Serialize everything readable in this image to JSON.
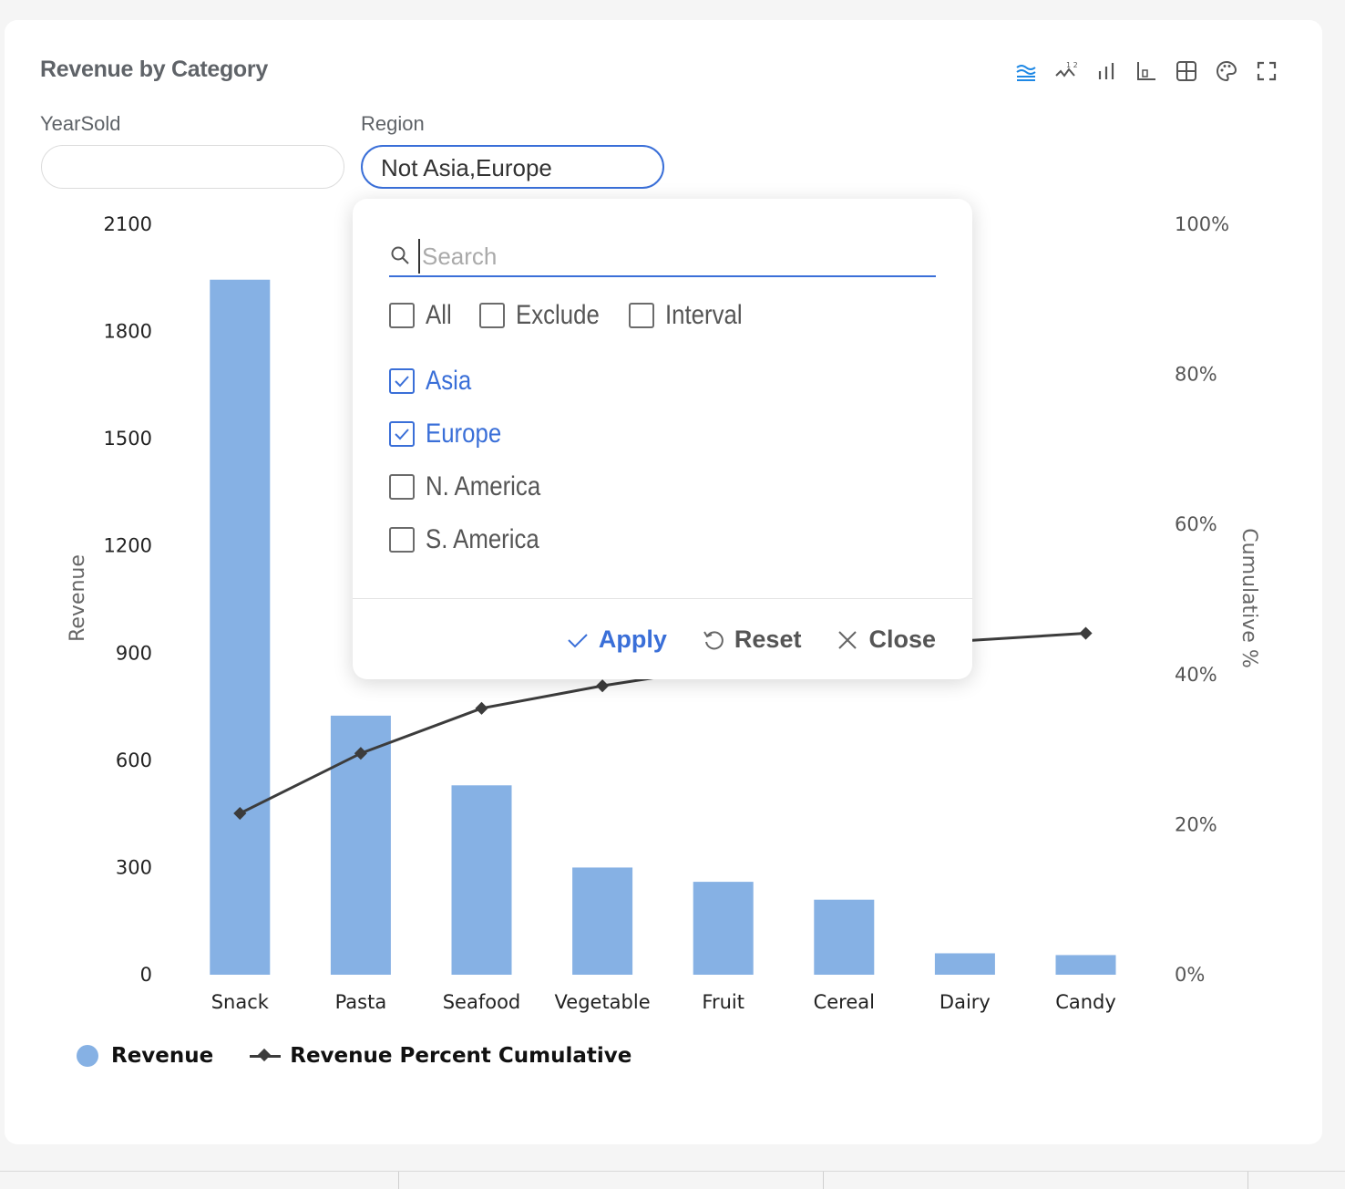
{
  "title": "Revenue by Category",
  "toolbar": {
    "icons": [
      "stacked-area-icon",
      "line-numbers-icon",
      "bar-chart-icon",
      "axis-icon",
      "grid-icon",
      "palette-icon",
      "fullscreen-icon"
    ]
  },
  "filters": {
    "yearsold": {
      "label": "YearSold",
      "value": ""
    },
    "region": {
      "label": "Region",
      "value": "Not Asia,Europe"
    }
  },
  "dropdown": {
    "search_placeholder": "Search",
    "modes": [
      {
        "label": "All",
        "checked": false
      },
      {
        "label": "Exclude",
        "checked": false
      },
      {
        "label": "Interval",
        "checked": false
      }
    ],
    "options": [
      {
        "label": "Asia",
        "checked": true
      },
      {
        "label": "Europe",
        "checked": true
      },
      {
        "label": "N. America",
        "checked": false
      },
      {
        "label": "S. America",
        "checked": false
      }
    ],
    "apply_label": "Apply",
    "reset_label": "Reset",
    "close_label": "Close"
  },
  "colors": {
    "bar": "#86b1e4",
    "line": "#3c3c3c",
    "accent": "#3a6fd8"
  },
  "chart_data": {
    "type": "bar",
    "categories": [
      "Snack",
      "Pasta",
      "Seafood",
      "Vegetable",
      "Fruit",
      "Cereal",
      "Dairy",
      "Candy"
    ],
    "series": [
      {
        "name": "Revenue",
        "type": "bar",
        "axis": "left",
        "values": [
          1945,
          725,
          530,
          300,
          260,
          210,
          60,
          55
        ]
      },
      {
        "name": "Revenue Percent Cumulative",
        "type": "line",
        "axis": "right",
        "values": [
          21.5,
          29.5,
          35.5,
          38.5,
          41,
          43.5,
          44.5,
          45.5
        ]
      }
    ],
    "ylabel": "Revenue",
    "y2label": "Cumulative %",
    "ylim": [
      0,
      2100
    ],
    "yticks": [
      "0",
      "300",
      "600",
      "900",
      "1200",
      "1500",
      "1800",
      "2100"
    ],
    "y2lim": [
      0,
      100
    ],
    "y2ticks": [
      "0%",
      "20%",
      "40%",
      "60%",
      "80%",
      "100%"
    ],
    "legend": "bottom-left",
    "grid": false
  }
}
